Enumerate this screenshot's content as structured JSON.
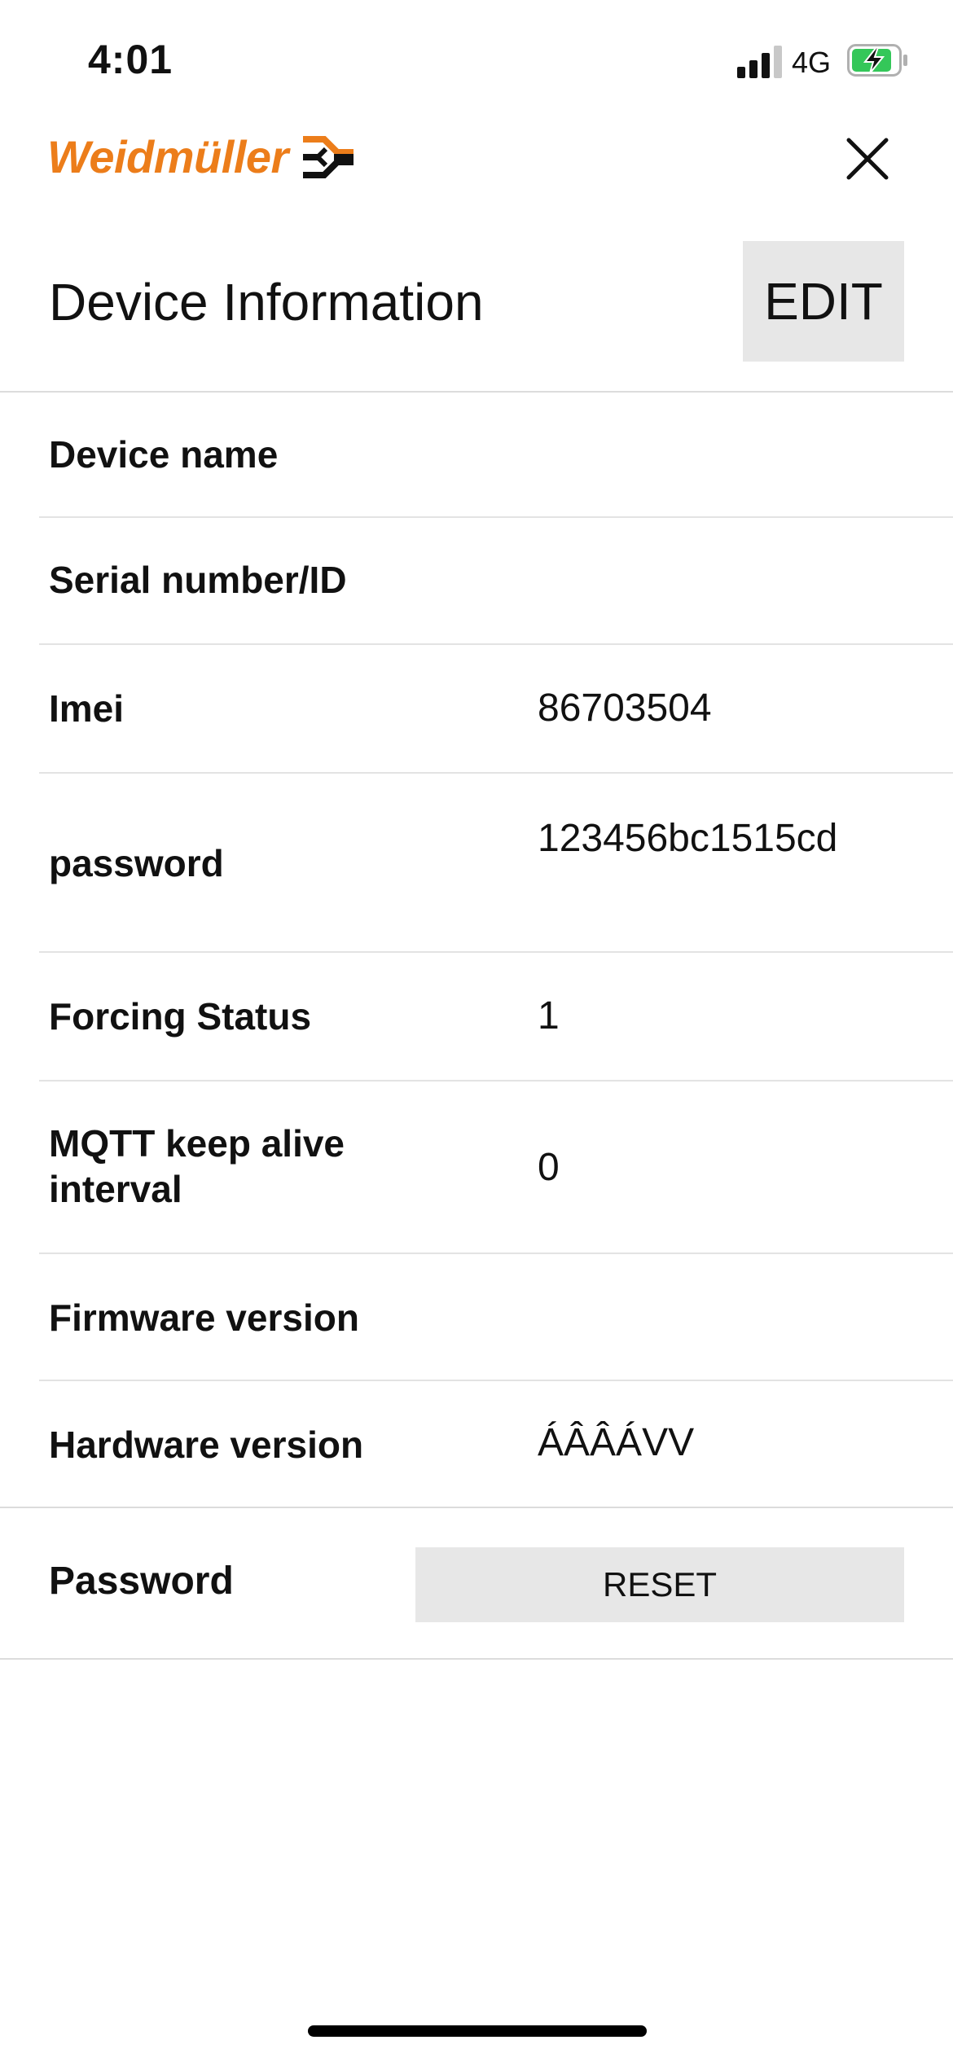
{
  "status_bar": {
    "time": "4:01",
    "network": "4G",
    "icons": [
      "signal-icon",
      "battery-charging-icon"
    ]
  },
  "header": {
    "brand": "Weidmüller",
    "brand_color": "#ec7d1a",
    "close_icon": "close-icon"
  },
  "title_row": {
    "title": "Device Information",
    "edit_label": "EDIT"
  },
  "info_rows": [
    {
      "label": "Device name",
      "value": ""
    },
    {
      "label": "Serial number/ID",
      "value": ""
    },
    {
      "label": "Imei",
      "value": "86703504"
    },
    {
      "label": "password",
      "value": "123456bc1515cd"
    },
    {
      "label": "Forcing Status",
      "value": "1"
    },
    {
      "label": "MQTT keep alive interval",
      "value": "0"
    },
    {
      "label": "Firmware version",
      "value": ""
    },
    {
      "label": "Hardware version",
      "value": "ÁÂÂÁVV"
    }
  ],
  "password_row": {
    "label": "Password",
    "reset_label": "RESET"
  }
}
